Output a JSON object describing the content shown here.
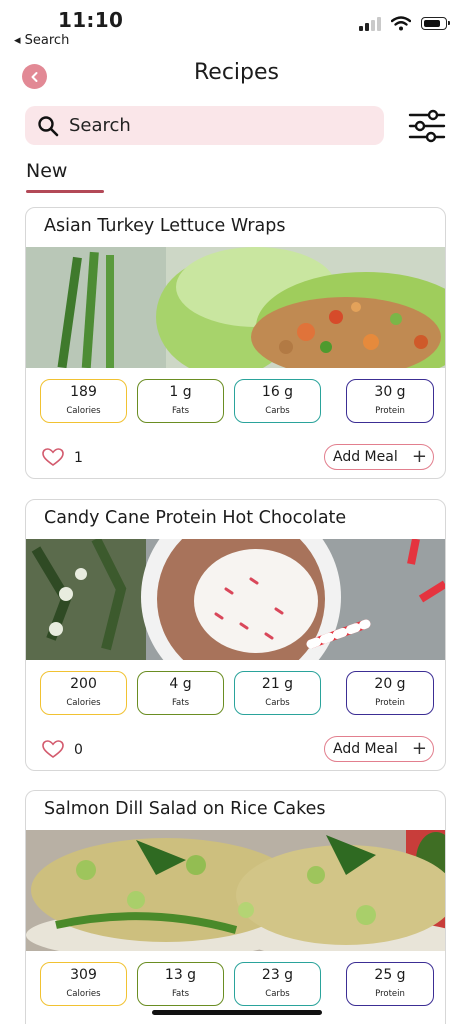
{
  "status_bar": {
    "time": "11:10",
    "back_app": "◂ Search"
  },
  "header": {
    "title": "Recipes"
  },
  "search": {
    "placeholder": "Search"
  },
  "section": {
    "label": "New"
  },
  "recipes": [
    {
      "title": "Asian Turkey Lettuce Wraps",
      "calories": "189",
      "fats": "1 g",
      "carbs": "16 g",
      "protein": "30 g",
      "likes": "1"
    },
    {
      "title": "Candy Cane Protein Hot Chocolate",
      "calories": "200",
      "fats": "4 g",
      "carbs": "21 g",
      "protein": "20 g",
      "likes": "0"
    },
    {
      "title": "Salmon Dill Salad on Rice Cakes",
      "calories": "309",
      "fats": "13 g",
      "carbs": "23 g",
      "protein": "25 g",
      "likes": ""
    }
  ],
  "labels": {
    "calories": "Calories",
    "fats": "Fats",
    "carbs": "Carbs",
    "protein": "Protein",
    "add_meal": "Add Meal",
    "add_icon": "+"
  },
  "icons": {
    "back": "chevron-left-icon",
    "search": "search-icon",
    "filter": "sliders-icon",
    "like": "heart-icon",
    "add": "plus-icon"
  },
  "colors": {
    "accent": "#e28995",
    "search_bg": "#fae6e9",
    "underline": "#b34957",
    "calories": "#f1c232",
    "fats": "#6a8d22",
    "carbs": "#2aa39b",
    "protein": "#3c2e94"
  }
}
